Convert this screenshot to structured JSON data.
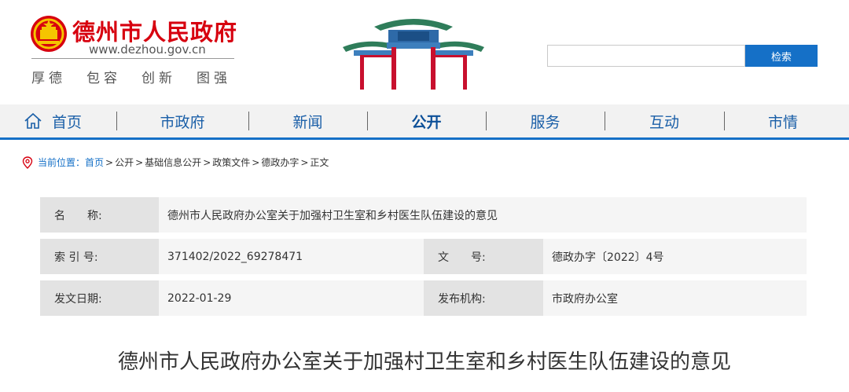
{
  "header": {
    "site_title": "德州市人民政府",
    "site_url": "www.dezhou.gov.cn",
    "slogan": [
      "厚德",
      "包容",
      "创新",
      "图强"
    ],
    "search": {
      "placeholder": "",
      "button_label": "检索"
    },
    "brand_color": "#d7000f",
    "accent_color": "#1570c7"
  },
  "nav": {
    "items": [
      {
        "label": "首页",
        "icon": "home-icon"
      },
      {
        "label": "市政府"
      },
      {
        "label": "新闻"
      },
      {
        "label": "公开",
        "active": true
      },
      {
        "label": "服务"
      },
      {
        "label": "互动"
      },
      {
        "label": "市情"
      }
    ]
  },
  "breadcrumb": {
    "prefix": "当前位置：",
    "items": [
      "首页",
      "公开",
      "基础信息公开",
      "政策文件",
      "德政办字",
      "正文"
    ],
    "separator": ">",
    "icon": "location-pin-icon"
  },
  "info": {
    "name_label": "名　　称:",
    "name_value": "德州市人民政府办公室关于加强村卫生室和乡村医生队伍建设的意见",
    "index_label": "索 引 号:",
    "index_value": "371402/2022_69278471",
    "doc_no_label": "文　　号:",
    "doc_no_value": "德政办字〔2022〕4号",
    "date_label": "发文日期:",
    "date_value": "2022-01-29",
    "issuer_label": "发布机构:",
    "issuer_value": "市政府办公室"
  },
  "article": {
    "title": "德州市人民政府办公室关于加强村卫生室和乡村医生队伍建设的意见"
  }
}
